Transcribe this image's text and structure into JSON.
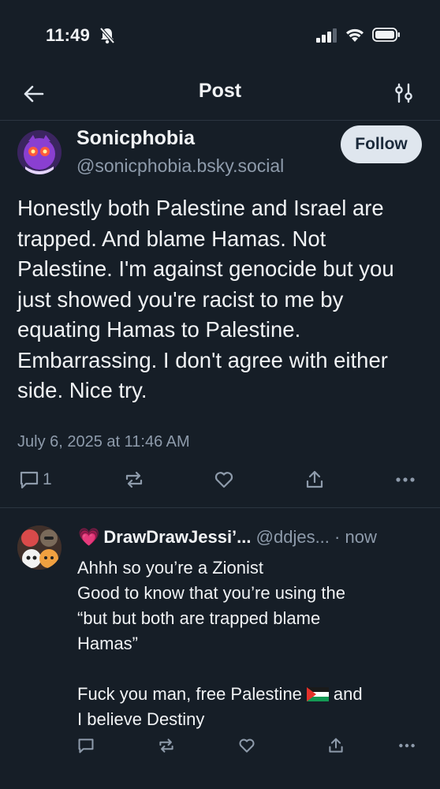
{
  "status_bar": {
    "time": "11:49"
  },
  "nav": {
    "title": "Post"
  },
  "post": {
    "author_name": "Sonicphobia",
    "author_handle": "@sonicphobia.bsky.social",
    "follow_label": "Follow",
    "text": "Honestly both Palestine and Israel are trapped. And blame Hamas. Not Palestine. I'm against genocide but you just showed you're racist to me by equating Hamas to Palestine. Embarrassing. I don't agree with either side. Nice try.",
    "date": "July 6, 2025 at 11:46 AM",
    "reply_count": "1"
  },
  "reply": {
    "emoji": "💗",
    "author_name": "DrawDrawJessi’...",
    "author_handle": "@ddjes...",
    "separator": "·",
    "time": "now",
    "lines": [
      "Ahhh so you’re a Zionist",
      "Good to know that you’re using the",
      "“but but both are trapped blame",
      "Hamas”",
      "",
      "Fuck you man, free Palestine",
      "and",
      "I believe Destiny"
    ]
  },
  "icons": {
    "back": "arrow-left-icon",
    "filter": "sliders-icon",
    "reply": "comment-icon",
    "repost": "repost-icon",
    "like": "heart-icon",
    "share": "share-icon",
    "more": "ellipsis-icon"
  }
}
